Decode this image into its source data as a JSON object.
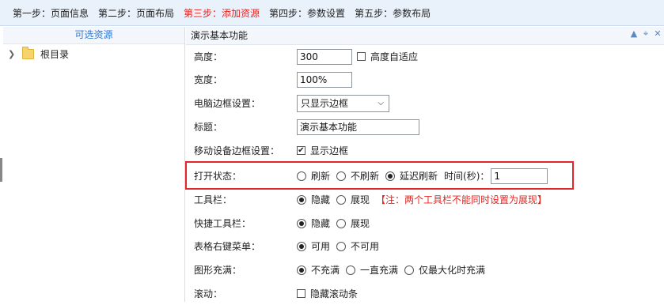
{
  "steps": [
    {
      "label": "第一步：页面信息",
      "active": false
    },
    {
      "label": "第二步：页面布局",
      "active": false
    },
    {
      "label": "第三步：添加资源",
      "active": true
    },
    {
      "label": "第四步：参数设置",
      "active": false
    },
    {
      "label": "第五步：参数布局",
      "active": false
    }
  ],
  "left_panel": {
    "title": "可选资源",
    "tree": [
      {
        "label": "根目录",
        "icon": "folder-icon"
      }
    ]
  },
  "right_panel": {
    "title": "演示基本功能",
    "tools": [
      "arrow-up-icon",
      "crosshair-icon",
      "trash-icon"
    ]
  },
  "form": {
    "height": {
      "label": "高度：",
      "value": "300",
      "checkbox_label": "高度自适应",
      "checked": false
    },
    "width": {
      "label": "宽度：",
      "value": "100%"
    },
    "pc_border": {
      "label": "电脑边框设置：",
      "selected": "只显示边框"
    },
    "title": {
      "label": "标题：",
      "value": "演示基本功能"
    },
    "mobile_border": {
      "label": "移动设备边框设置：",
      "checkbox_label": "显示边框",
      "checked": true
    },
    "open_state": {
      "label": "打开状态：",
      "options": [
        "刷新",
        "不刷新",
        "延迟刷新"
      ],
      "selected": "延迟刷新",
      "time_label": "时间(秒)：",
      "time_value": "1"
    },
    "toolbar": {
      "label": "工具栏：",
      "options": [
        "隐藏",
        "展现"
      ],
      "selected": "隐藏",
      "note": "【注：两个工具栏不能同时设置为展现】"
    },
    "quick_toolbar": {
      "label": "快捷工具栏：",
      "options": [
        "隐藏",
        "展现"
      ],
      "selected": "隐藏"
    },
    "context_menu": {
      "label": "表格右键菜单：",
      "options": [
        "可用",
        "不可用"
      ],
      "selected": "可用"
    },
    "fill": {
      "label": "图形充满：",
      "options": [
        "不充满",
        "一直充满",
        "仅最大化时充满"
      ],
      "selected": "不充满"
    },
    "scroll": {
      "label": "滚动：",
      "checkbox_label": "隐藏滚动条",
      "checked": false
    }
  },
  "colors": {
    "accent": "#2f77d1",
    "active_step": "#e8231f",
    "highlight": "#e0272a"
  }
}
